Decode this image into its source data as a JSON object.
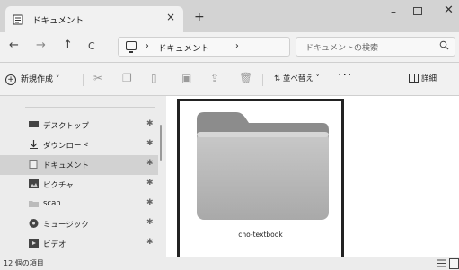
{
  "window": {
    "tab_title": "ドキュメント",
    "tab_close": "×",
    "new_tab": "+",
    "minimize": "–",
    "close": "✕"
  },
  "nav": {
    "back": "←",
    "forward": "→",
    "up": "↑",
    "refresh": "C",
    "breadcrumb_sep": "›",
    "breadcrumb_current": "ドキュメント",
    "search_placeholder": "ドキュメントの検索",
    "search_icon": "search-icon"
  },
  "commands": {
    "new_label": "新規作成 ˅",
    "sort_label": "⇅ 並べ替え ˅",
    "more": "···",
    "details_label": "詳細"
  },
  "sidebar": {
    "items": [
      {
        "label": "デスクトップ",
        "icon": "desktop-icon",
        "pin": "✱"
      },
      {
        "label": "ダウンロード",
        "icon": "download-icon",
        "pin": "✱"
      },
      {
        "label": "ドキュメント",
        "icon": "document-icon",
        "pin": "✱",
        "selected": true
      },
      {
        "label": "ピクチャ",
        "icon": "pictures-icon",
        "pin": "✱"
      },
      {
        "label": "scan",
        "icon": "folder-icon",
        "pin": "✱"
      },
      {
        "label": "ミュージック",
        "icon": "music-icon",
        "pin": "✱"
      },
      {
        "label": "ビデオ",
        "icon": "video-icon",
        "pin": "✱"
      }
    ]
  },
  "main": {
    "items": [
      {
        "name": "cho-textbook",
        "type": "folder"
      }
    ]
  },
  "status": {
    "count_text": "12 個の項目"
  },
  "colors": {
    "titlebar": "#d3d3d3",
    "chrome": "#f1f1f1",
    "sidebar": "#ececec",
    "selected": "#d2d2d2",
    "folder": "#b8b8b8"
  }
}
